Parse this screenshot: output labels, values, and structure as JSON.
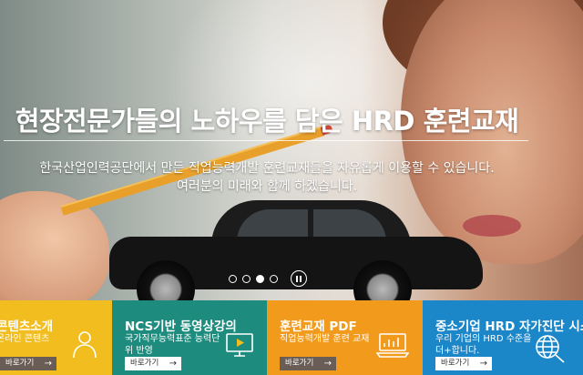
{
  "hero": {
    "headline": "현장전문가들의 노하우를 담은 HRD 훈련교재",
    "sub_line1": "한국산업인력공단에서 만든 직업능력개발 훈련교재들을 자유롭게 이용할 수 있습니다.",
    "sub_line2": "여러분의 미래와 함께 하겠습니다.",
    "slides": {
      "count": 4,
      "active_index": 3
    },
    "icons": [
      "pause-icon"
    ]
  },
  "cards": [
    {
      "title": "콘텐츠소개",
      "desc": "온라인 콘텐츠",
      "button": "바로가기",
      "arrow": "→",
      "icon": "person-icon",
      "color": "#f2bd1f"
    },
    {
      "title": "NCS기반 동영상강의",
      "desc": "국가직무능력표준 능력단위 반영",
      "button": "바로가기",
      "arrow": "→",
      "icon": "video-monitor-icon",
      "color": "#1d8c7e"
    },
    {
      "title": "훈련교재 PDF",
      "desc": "직업능력개발 훈련 교재",
      "button": "바로가기",
      "arrow": "→",
      "icon": "chart-monitor-icon",
      "color": "#f19a1b"
    },
    {
      "title": "중소기업 HRD 자가진단 시스템",
      "desc": "우리 기업의 HRD 수준을 더+합니다.",
      "button": "바로가기",
      "arrow": "→",
      "icon": "globe-search-icon",
      "color": "#1b86c8"
    }
  ]
}
